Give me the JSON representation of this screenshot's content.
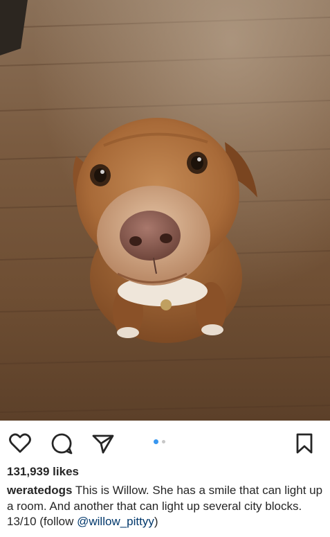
{
  "post": {
    "photo_description_icon": "dog-photo",
    "likes_text": "131,939 likes",
    "username": "weratedogs",
    "caption_text": " This is Willow. She has a smile that can light up a room. And another that can light up several city blocks. 13/10 (follow ",
    "mention": "@willow_pittyy",
    "caption_end": ")"
  },
  "actions": {
    "icons": [
      "heart-icon",
      "comment-icon",
      "share-icon",
      "bookmark-icon"
    ]
  },
  "carousel": {
    "total": 2,
    "active_index": 0,
    "active_color": "#3897f0",
    "inactive_color": "#c7c7c7"
  }
}
